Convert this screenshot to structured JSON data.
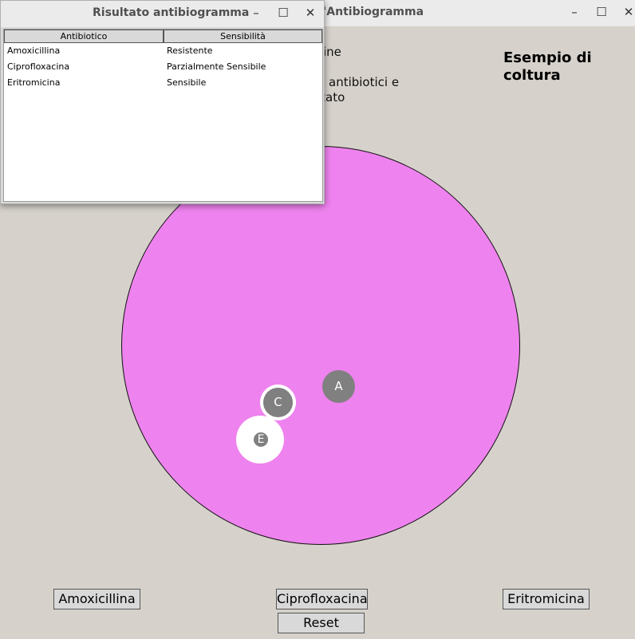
{
  "main_window": {
    "title": "'Antibiogramma",
    "controls": {
      "minimize": "–",
      "maximize": "☐",
      "close": "✕"
    },
    "instructions": [
      "ine",
      "e antibiotici e",
      "ltato"
    ],
    "culture_title": "Esempio di coltura",
    "petri_color": "#ee82ee",
    "discs": [
      {
        "label": "A"
      },
      {
        "label": "C"
      },
      {
        "label": "E"
      }
    ],
    "buttons": {
      "amoxicillina": "Amoxicillina",
      "ciprofloxacina": "Ciprofloxacina",
      "eritromicina": "Eritromicina",
      "reset": "Reset"
    }
  },
  "result_window": {
    "title": "Risultato antibiogramma",
    "controls": {
      "minimize": "–",
      "maximize": "☐",
      "close": "✕"
    },
    "columns": [
      "Antibiotico",
      "Sensibilità"
    ],
    "rows": [
      {
        "antibiotic": "Amoxicillina",
        "sensitivity": "Resistente"
      },
      {
        "antibiotic": "Ciprofloxacina",
        "sensitivity": "Parzialmente Sensibile"
      },
      {
        "antibiotic": "Eritromicina",
        "sensitivity": "Sensibile"
      }
    ]
  }
}
